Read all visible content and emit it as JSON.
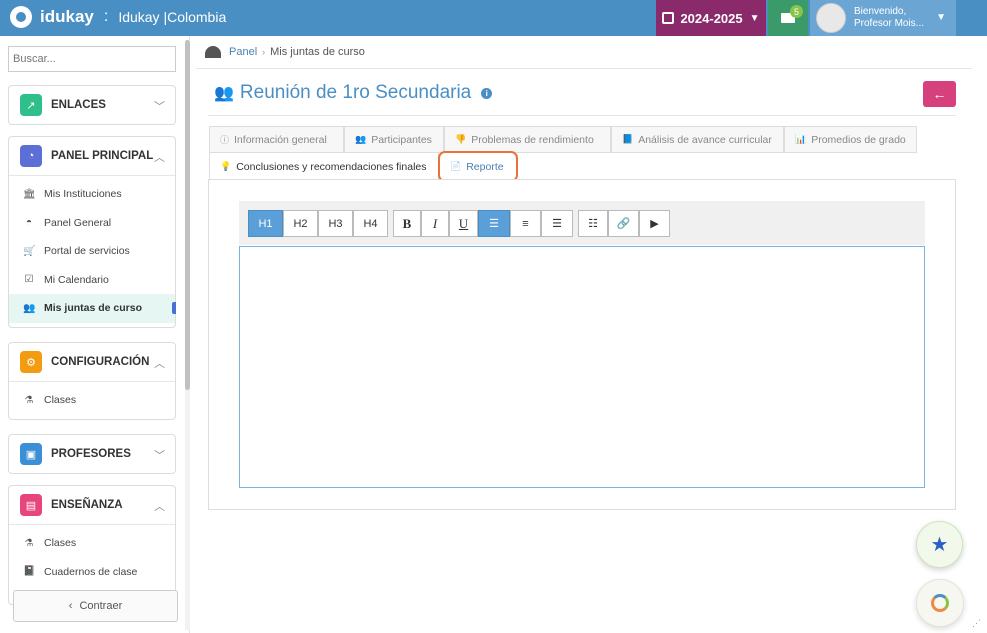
{
  "topbar": {
    "logo_text": "idukay",
    "separator": ":",
    "app_name": "Idukay |Colombia",
    "year": "2024-2025",
    "mail_count": "5",
    "user_greeting": "Bienvenido,",
    "user_name": "Profesor Mois..."
  },
  "sidebar": {
    "search_placeholder": "Buscar...",
    "sections": [
      {
        "title": "ENLACES",
        "color": "#2fbf8a"
      },
      {
        "title": "PANEL PRINCIPAL",
        "color": "#5b6fd6",
        "items": [
          "Mis Instituciones",
          "Panel General",
          "Portal de servicios",
          "Mi Calendario",
          "Mis juntas de curso"
        ]
      },
      {
        "title": "CONFIGURACIÓN",
        "color": "#f39c12",
        "items": [
          "Clases"
        ]
      },
      {
        "title": "PROFESORES",
        "color": "#3a8fd6"
      },
      {
        "title": "ENSEÑANZA",
        "color": "#e8457c",
        "items": [
          "Clases",
          "Cuadernos de clase"
        ]
      }
    ],
    "back_label": "Contraer"
  },
  "breadcrumb": {
    "root": "Panel",
    "current": "Mis juntas de curso"
  },
  "page": {
    "title": "Reunión de 1ro Secundaria"
  },
  "tabs": [
    "Información general",
    "Participantes",
    "Problemas de rendimiento",
    "Análisis de avance curricular",
    "Promedios de grado",
    "Conclusiones y recomendaciones finales",
    "Reporte"
  ],
  "toolbar": {
    "h1": "H1",
    "h2": "H2",
    "h3": "H3",
    "h4": "H4",
    "bold": "B",
    "italic": "I",
    "underline": "U"
  },
  "colors": {
    "accent": "#4a8fc4",
    "year": "#8b2a6a",
    "mail": "#3a9a6a",
    "back": "#d6407c",
    "highlight": "#e8733a"
  }
}
